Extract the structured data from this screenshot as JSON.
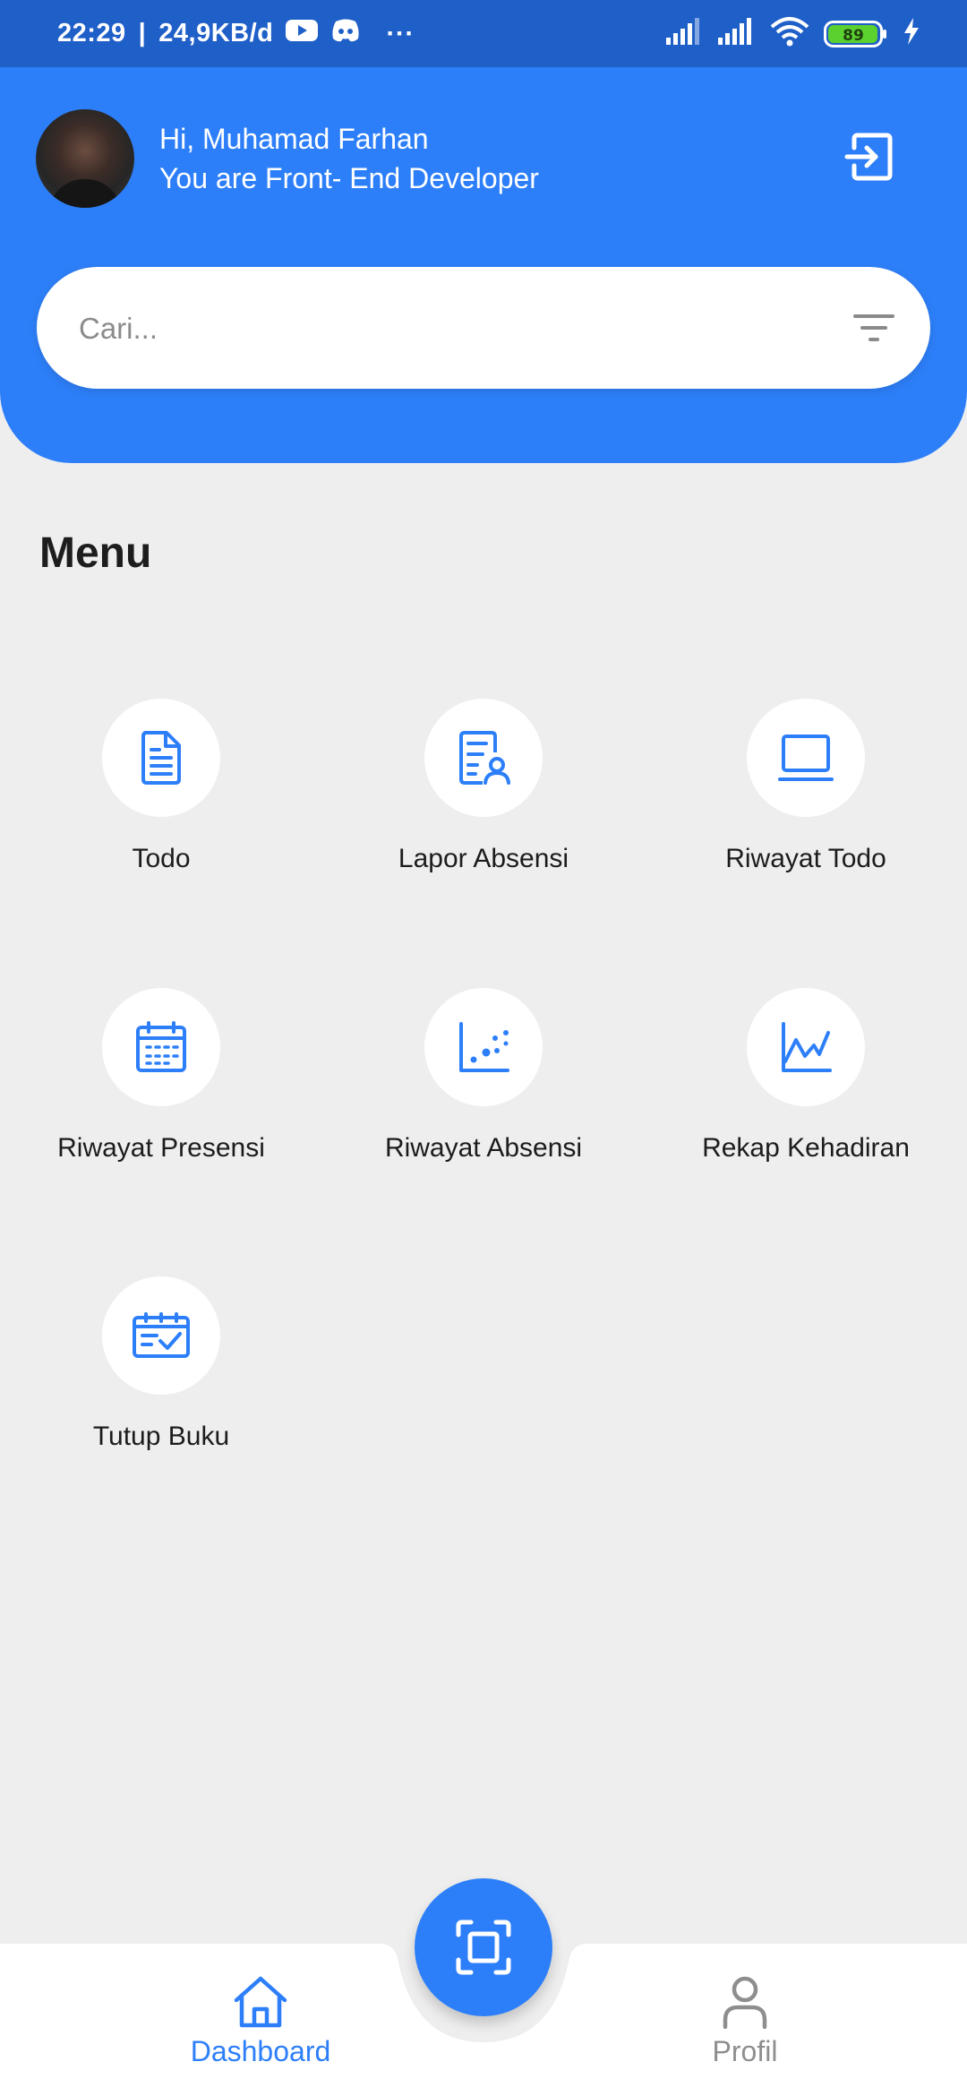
{
  "status_bar": {
    "time": "22:29",
    "separator": "|",
    "network_speed": "24,9KB/d",
    "more_indicator": "···",
    "battery_level": "89"
  },
  "header": {
    "greeting": "Hi, Muhamad Farhan",
    "role": "You are Front- End Developer"
  },
  "search": {
    "placeholder": "Cari..."
  },
  "menu": {
    "title": "Menu",
    "items": [
      {
        "label": "Todo",
        "icon": "document-icon"
      },
      {
        "label": "Lapor Absensi",
        "icon": "report-user-icon"
      },
      {
        "label": "Riwayat Todo",
        "icon": "laptop-icon"
      },
      {
        "label": "Riwayat Presensi",
        "icon": "calendar-icon"
      },
      {
        "label": "Riwayat Absensi",
        "icon": "scatter-chart-icon"
      },
      {
        "label": "Rekap Kehadiran",
        "icon": "line-chart-icon"
      },
      {
        "label": "Tutup Buku",
        "icon": "calendar-check-icon"
      }
    ]
  },
  "bottom_nav": {
    "dashboard_label": "Dashboard",
    "profil_label": "Profil",
    "active": "Dashboard"
  },
  "colors": {
    "primary": "#2d7ff9",
    "status_bar": "#1f5fc8",
    "background": "#eeeeee",
    "inactive": "#8e8e8e",
    "battery_green": "#5ad12e"
  }
}
